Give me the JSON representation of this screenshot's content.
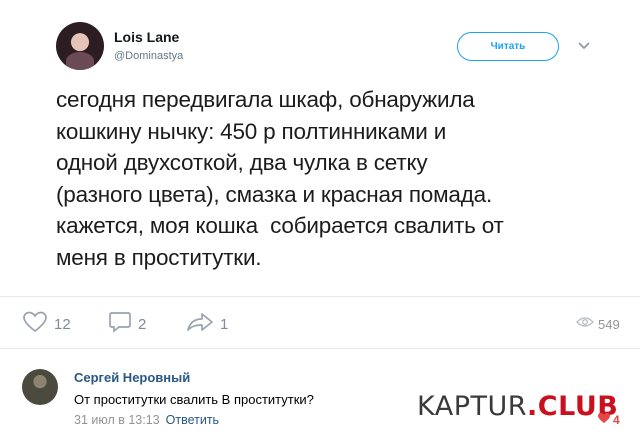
{
  "tweet": {
    "author_name": "Lois Lane",
    "author_handle": "@Dominastya",
    "follow_label": "Читать",
    "text": "сегодня передвигала шкаф, обнаружила\nкошкину нычку: 450 р полтинниками и\nодной двухсоткой, два чулка в сетку\n(разного цвета), смазка и красная помада.\nкажется, моя кошка  собирается свалить от\nменя в проститутки."
  },
  "actions": {
    "likes": "12",
    "comments": "2",
    "shares": "1",
    "views": "549"
  },
  "comment": {
    "author": "Сергей Неровный",
    "text": "От проститутки свалить В проститутки?",
    "time": "31 июл в 13:13",
    "reply_label": "Ответить",
    "likes": "4"
  },
  "watermark": {
    "part1": "KAPTUR",
    "part2": ".CLUB"
  },
  "colors": {
    "accent": "#1da1f2",
    "link": "#2a5885",
    "muted": "#828a99",
    "like": "#e64646",
    "brand_red": "#c8101e"
  }
}
